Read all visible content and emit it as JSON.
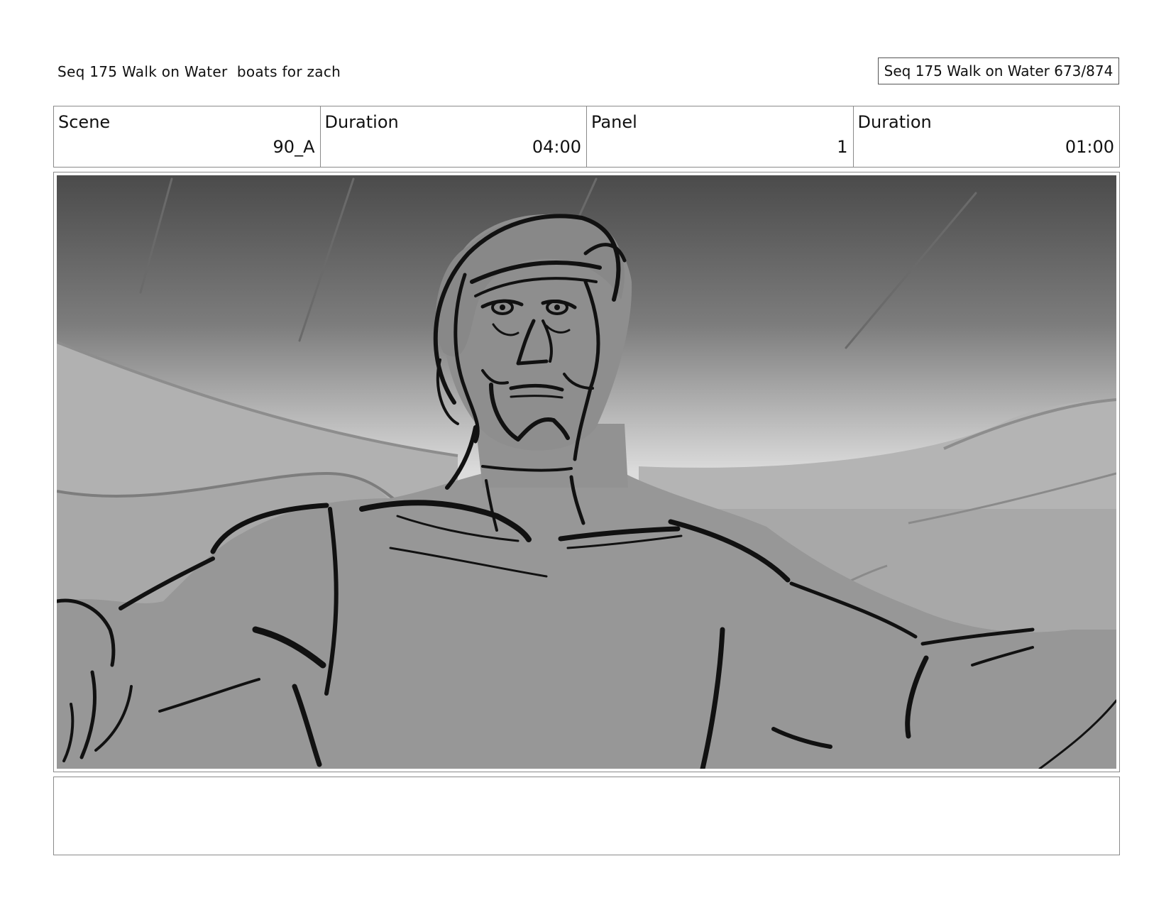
{
  "header": {
    "title": "Seq 175 Walk on Water  boats for zach",
    "page_tag": "Seq 175 Walk on Water 673/874"
  },
  "info": [
    {
      "label": "Scene",
      "value": "90_A"
    },
    {
      "label": "Duration",
      "value": "04:00"
    },
    {
      "label": "Panel",
      "value": "1"
    },
    {
      "label": "Duration",
      "value": "01:00"
    }
  ],
  "panel": {
    "image": "grayscale storyboard sketch: low-angle view of a bearded man with headband and outstretched arms against wave crests and a dark gradient sky"
  },
  "notes": {
    "text": ""
  }
}
